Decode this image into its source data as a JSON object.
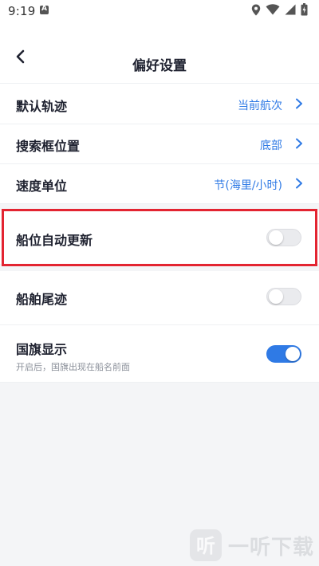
{
  "status_bar": {
    "time": "9:19",
    "icons": [
      "a-notification-icon",
      "location-icon",
      "wifi-icon",
      "signal-icon",
      "battery-icon"
    ]
  },
  "header": {
    "title": "偏好设置",
    "back_icon": "back-arrow-icon"
  },
  "settings": {
    "default_track": {
      "label": "默认轨迹",
      "value": "当前航次"
    },
    "search_position": {
      "label": "搜索框位置",
      "value": "底部"
    },
    "speed_unit": {
      "label": "速度单位",
      "value": "节(海里/小时)"
    },
    "auto_update": {
      "label": "船位自动更新",
      "enabled": false
    },
    "ship_trail": {
      "label": "船舶尾迹",
      "enabled": false
    },
    "flag_display": {
      "label": "国旗显示",
      "description": "开启后，国旗出现在船名前面",
      "enabled": true
    }
  },
  "colors": {
    "accent": "#2f7ae5",
    "highlight": "#e32431",
    "background": "#f4f5f7"
  },
  "watermark": {
    "logo_char": "听",
    "text": "一听下载"
  }
}
